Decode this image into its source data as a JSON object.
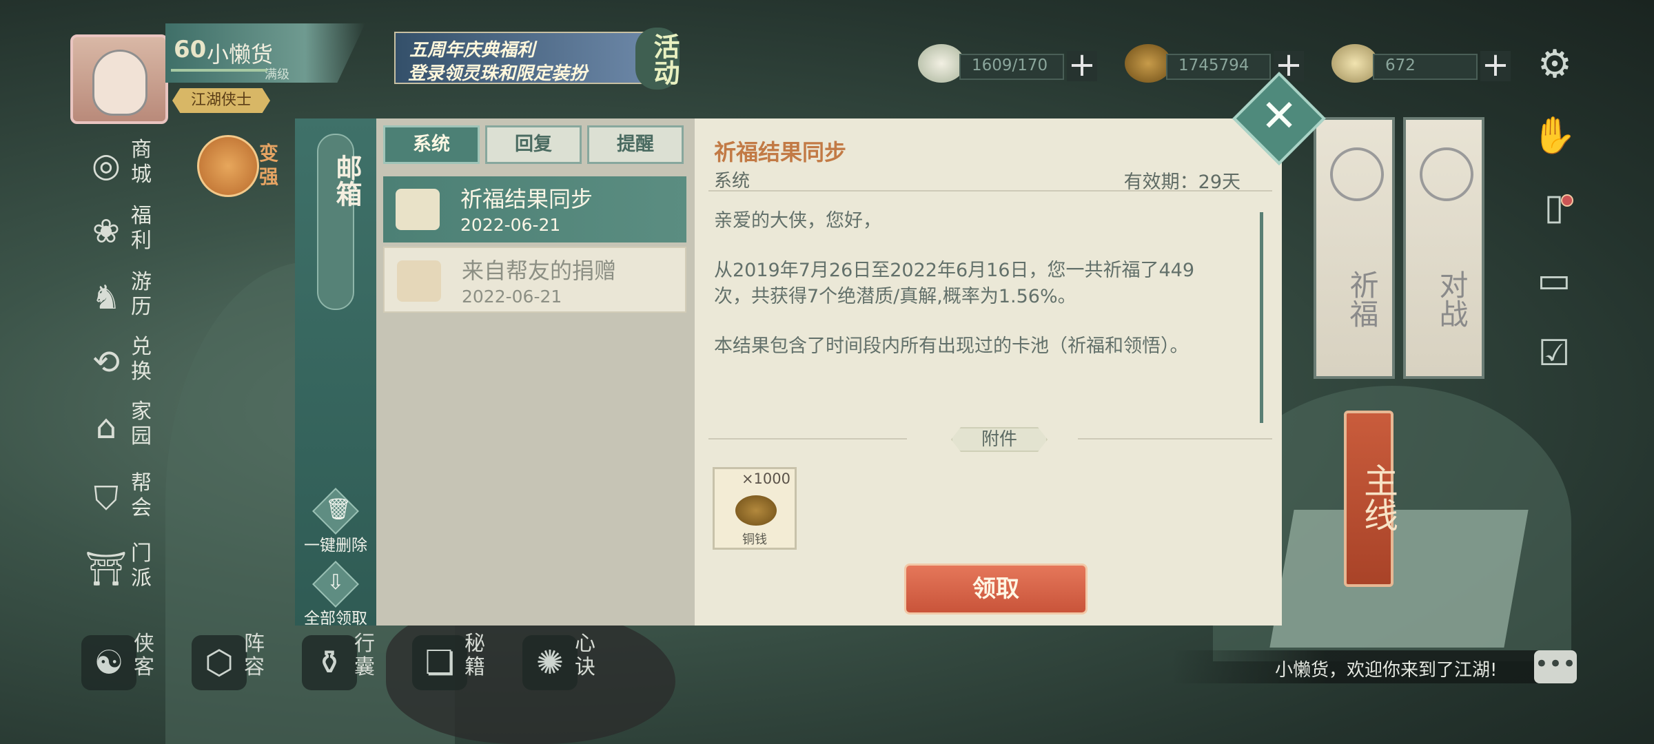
{
  "player": {
    "level": "60",
    "name": "小懒货",
    "exp_label": "满级",
    "title": "江湖侠士"
  },
  "event_banner": {
    "line1": "五周年庆典福利",
    "line2": "登录领灵珠和限定装扮",
    "badge": "活动"
  },
  "resources": [
    {
      "icon": "steamed-bun-icon",
      "value": "1609/170"
    },
    {
      "icon": "copper-coin-icon",
      "value": "1745794"
    },
    {
      "icon": "gold-ingot-icon",
      "value": "672"
    }
  ],
  "left_menu": [
    {
      "label": "商城",
      "icon": "shop-icon"
    },
    {
      "label": "福利",
      "icon": "gift-icon"
    },
    {
      "label": "游历",
      "icon": "horse-icon"
    },
    {
      "label": "兑换",
      "icon": "exchange-icon"
    },
    {
      "label": "家园",
      "icon": "home-icon"
    },
    {
      "label": "帮会",
      "icon": "guild-icon"
    },
    {
      "label": "门派",
      "icon": "sect-icon"
    }
  ],
  "strengthen_label": "变强",
  "bottom_bar": [
    {
      "label": "侠客",
      "icon": "hero-icon"
    },
    {
      "label": "阵容",
      "icon": "formation-icon"
    },
    {
      "label": "行囊",
      "icon": "bag-icon"
    },
    {
      "label": "秘籍",
      "icon": "book-icon"
    },
    {
      "label": "心诀",
      "icon": "skill-icon"
    }
  ],
  "right_scrolls": [
    {
      "label": "祈福"
    },
    {
      "label": "对战"
    }
  ],
  "main_quest_label": "主线",
  "welcome_message": "小懒货，欢迎你来到了江湖!",
  "mailbox": {
    "title": "邮箱",
    "tabs": [
      "系统",
      "回复",
      "提醒"
    ],
    "active_tab": 0,
    "delete_all_label": "一键删除",
    "claim_all_label": "全部领取",
    "mails": [
      {
        "title": "祈福结果同步",
        "date": "2022-06-21",
        "selected": true
      },
      {
        "title": "来自帮友的捐赠",
        "date": "2022-06-21",
        "selected": false
      }
    ],
    "detail": {
      "subject": "祈福结果同步",
      "sender": "系统",
      "validity": "有效期：29天",
      "paragraphs": [
        "亲爱的大侠，您好，",
        "从2019年7月26日至2022年6月16日，您一共祈福了449次，共获得7个绝潜质/真解,概率为1.56%。",
        "本结果包含了时间段内所有出现过的卡池（祈福和领悟）。"
      ],
      "attachments_label": "附件",
      "attachment": {
        "quantity": "×1000",
        "name": "铜钱",
        "icon": "copper-coin-icon"
      },
      "claim_button": "领取"
    }
  }
}
